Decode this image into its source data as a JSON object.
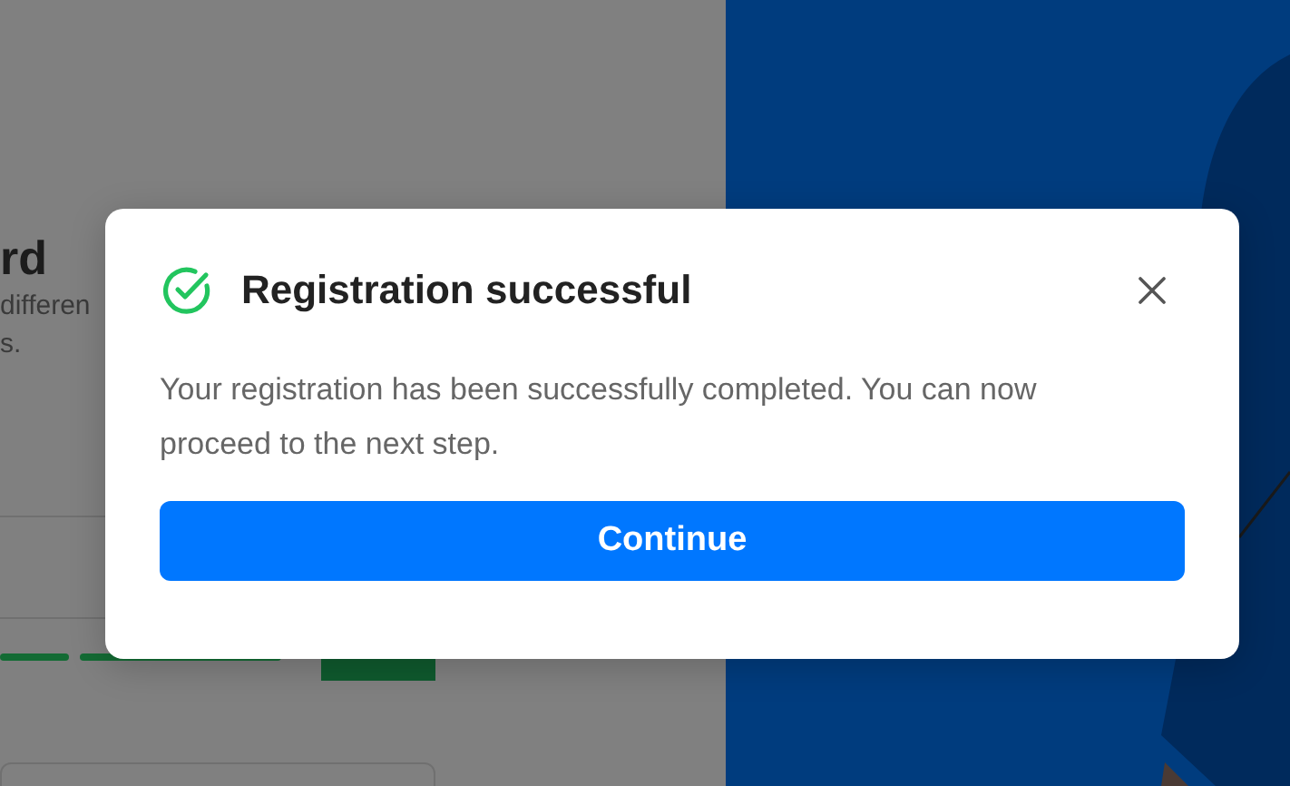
{
  "background_page": {
    "heading": "rd",
    "subtitle_lines": [
      "differen",
      "s."
    ]
  },
  "dialog": {
    "title": "Registration successful",
    "message": "Your registration has been successfully completed. You can now proceed to the next step.",
    "button": "Continue"
  }
}
